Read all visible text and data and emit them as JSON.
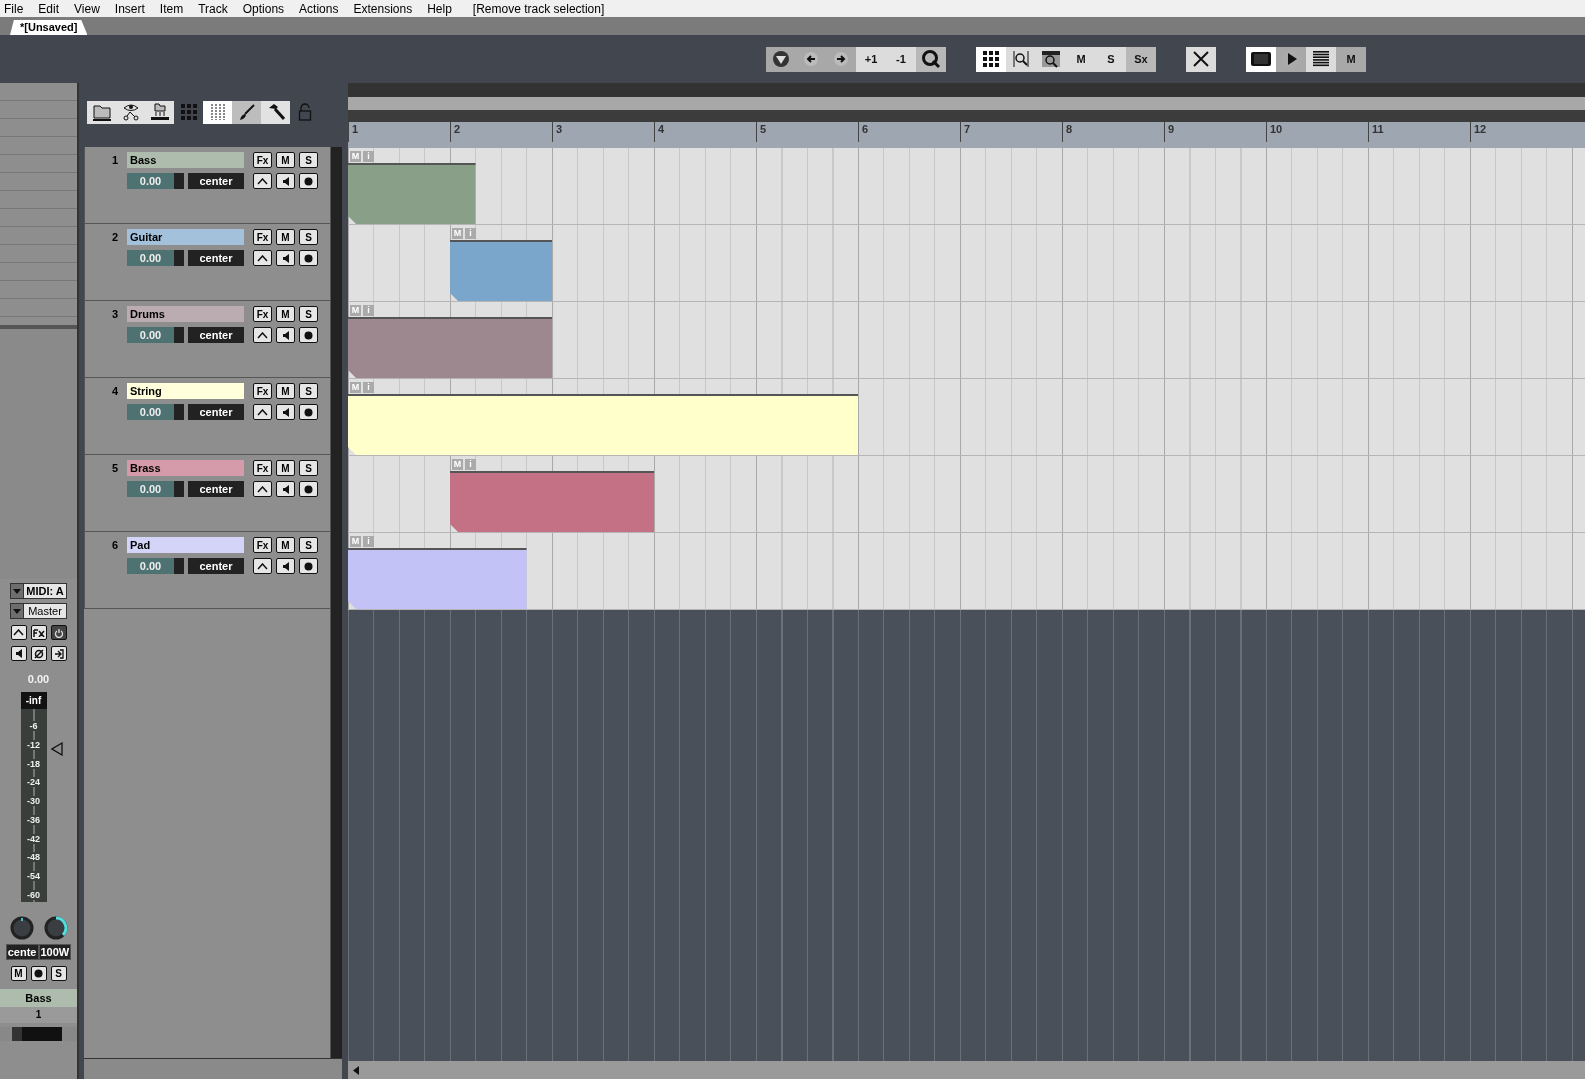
{
  "menu": [
    "File",
    "Edit",
    "View",
    "Insert",
    "Item",
    "Track",
    "Options",
    "Actions",
    "Extensions",
    "Help"
  ],
  "menu_action": "[Remove track selection]",
  "project_tab": "*[Unsaved]",
  "transport": {
    "nudge_buttons": [
      "+1",
      "-1"
    ],
    "toggle_buttons": [
      "M",
      "S",
      "Sx"
    ],
    "midi_button": "M"
  },
  "ruler": [
    "1",
    "2",
    "3",
    "4",
    "5",
    "6",
    "7",
    "8",
    "9",
    "10",
    "11",
    "12"
  ],
  "tracks": [
    {
      "number": "1",
      "name": "Bass",
      "color": "#8a9f88",
      "volume": "0.00",
      "level": 0.82,
      "pan": "center",
      "buttons": [
        "Fx",
        "M",
        "S"
      ],
      "item": {
        "buttons": [
          "M",
          "i"
        ]
      }
    },
    {
      "number": "2",
      "name": "Guitar",
      "color": "#7ba6cb",
      "volume": "0.00",
      "level": 0.82,
      "pan": "center",
      "buttons": [
        "Fx",
        "M",
        "S"
      ],
      "item": {
        "buttons": [
          "M",
          "i"
        ]
      }
    },
    {
      "number": "3",
      "name": "Drums",
      "color": "#9e8890",
      "volume": "0.00",
      "level": 0.82,
      "pan": "center",
      "buttons": [
        "Fx",
        "M",
        "S"
      ],
      "item": {
        "buttons": [
          "M",
          "i"
        ]
      }
    },
    {
      "number": "4",
      "name": "String",
      "color": "#ffffcc",
      "volume": "0.00",
      "level": 0.82,
      "pan": "center",
      "buttons": [
        "Fx",
        "M",
        "S"
      ],
      "item": {
        "buttons": [
          "M",
          "i"
        ]
      }
    },
    {
      "number": "5",
      "name": "Brass",
      "color": "#c47085",
      "volume": "0.00",
      "level": 0.82,
      "pan": "center",
      "buttons": [
        "Fx",
        "M",
        "S"
      ],
      "item": {
        "buttons": [
          "M",
          "i"
        ]
      }
    },
    {
      "number": "6",
      "name": "Pad",
      "color": "#c2c2f6",
      "volume": "0.00",
      "level": 0.82,
      "pan": "center",
      "buttons": [
        "Fx",
        "M",
        "S"
      ],
      "item": {
        "buttons": [
          "M",
          "i"
        ]
      }
    }
  ],
  "mixer_strip": {
    "input": "MIDI: A",
    "output": "Master",
    "volume": "0.00",
    "peak": "-inf",
    "scale": [
      "-6",
      "-12",
      "-18",
      "-24",
      "-30",
      "-36",
      "-42",
      "-48",
      "-54",
      "-60"
    ],
    "fader": {
      "level": 0.79
    },
    "pan": "cente",
    "width": "100W",
    "buttons": [
      "M",
      "S"
    ],
    "track_name": "Bass",
    "track_number": "1"
  }
}
